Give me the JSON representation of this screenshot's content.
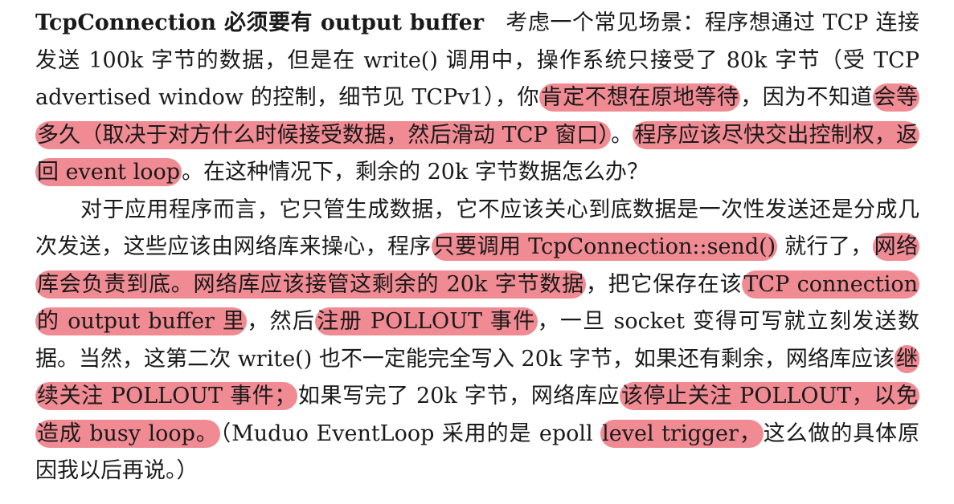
{
  "paragraph1": {
    "heading": "TcpConnection 必须要有 output buffer",
    "segments": [
      {
        "text": "考虑一个常见场景：程序想通过 TCP 连接发送 100k 字节的数据，但是在 write() 调用中，操作系统只接受了 80k 字节（受 TCP advertised window 的控制，细节见 TCPv1），你",
        "highlight": false
      },
      {
        "text": "肯定不想在原地等待",
        "highlight": true
      },
      {
        "text": "，因为不知道",
        "highlight": false
      },
      {
        "text": "会等多久（取决于对方什么时候接受数据，然后滑动 TCP 窗口）",
        "highlight": true
      },
      {
        "text": "。",
        "highlight": false
      },
      {
        "text": "程序应该尽快交出控制权，返回 event loop",
        "highlight": true
      },
      {
        "text": "。在这种情况下，剩余的 20k 字节数据怎么办？",
        "highlight": false
      }
    ]
  },
  "paragraph2": {
    "segments": [
      {
        "text": "对于应用程序而言，它只管生成数据，它不应该关心到底数据是一次性发送还是分成几次发送，这些应该由网络库来操心，程序",
        "highlight": false
      },
      {
        "text": "只要调用 TcpConnection::send()",
        "highlight": true
      },
      {
        "text": " 就行了，",
        "highlight": false
      },
      {
        "text": "网络库会负责到底。网络库应该接管这剩余的 20k 字节数据",
        "highlight": true
      },
      {
        "text": "，把它保存在该",
        "highlight": false
      },
      {
        "text": "TCP connection 的 output buffer 里",
        "highlight": true
      },
      {
        "text": "，然后",
        "highlight": false
      },
      {
        "text": "注册 POLLOUT 事件",
        "highlight": true
      },
      {
        "text": "，一旦 socket 变得可写就立刻发送数据。当然，这第二次 write() 也不一定能完全写入 20k 字节，如果还有剩余，网络库应该",
        "highlight": false
      },
      {
        "text": "继续关注 POLLOUT 事件；",
        "highlight": true
      },
      {
        "text": "如果写完了 20k 字节，网络库应",
        "highlight": false
      },
      {
        "text": "该停止关注 POLLOUT，以免造成 busy loop。",
        "highlight": true
      },
      {
        "text": "（Muduo EventLoop 采用的是 epoll ",
        "highlight": false
      },
      {
        "text": "level trigger，",
        "highlight": true
      },
      {
        "text": "这么做的具体原因我以后再说。）",
        "highlight": false
      }
    ]
  },
  "colors": {
    "highlight": "#f08a93",
    "text": "#1a1a1a"
  }
}
